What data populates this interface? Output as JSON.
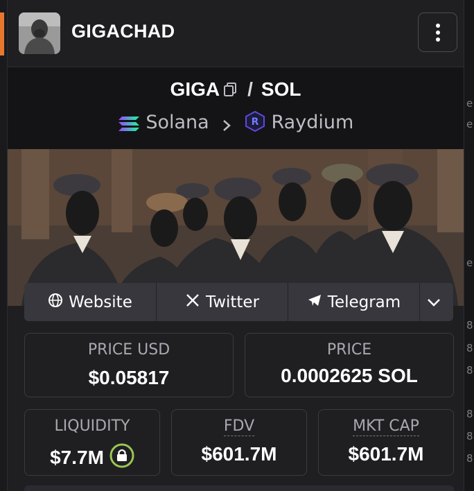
{
  "header": {
    "token_name": "GIGACHAD",
    "menu_icon": "more-vertical-icon"
  },
  "pair": {
    "base": "GIGA",
    "separator": "/",
    "quote": "SOL",
    "chain": "Solana",
    "dex": "Raydium"
  },
  "links": [
    {
      "label": "Website",
      "icon": "globe-icon"
    },
    {
      "label": "Twitter",
      "icon": "x-logo-icon"
    },
    {
      "label": "Telegram",
      "icon": "telegram-icon"
    }
  ],
  "stats": {
    "price_usd": {
      "label": "PRICE USD",
      "value": "$0.05817"
    },
    "price_native": {
      "label": "PRICE",
      "value": "0.0002625 SOL"
    },
    "liquidity": {
      "label": "LIQUIDITY",
      "value": "$7.7M"
    },
    "fdv": {
      "label": "FDV",
      "value": "$601.7M"
    },
    "mkt_cap": {
      "label": "MKT CAP",
      "value": "$601.7M"
    }
  },
  "colors": {
    "accent_orange": "#e8772e",
    "lock_ring": "#9bc653",
    "raydium_purple": "#5c4ae0"
  },
  "right_edge_fragments": [
    "e",
    "e",
    "e",
    "8",
    "8",
    "8",
    "8",
    "8",
    "8"
  ]
}
